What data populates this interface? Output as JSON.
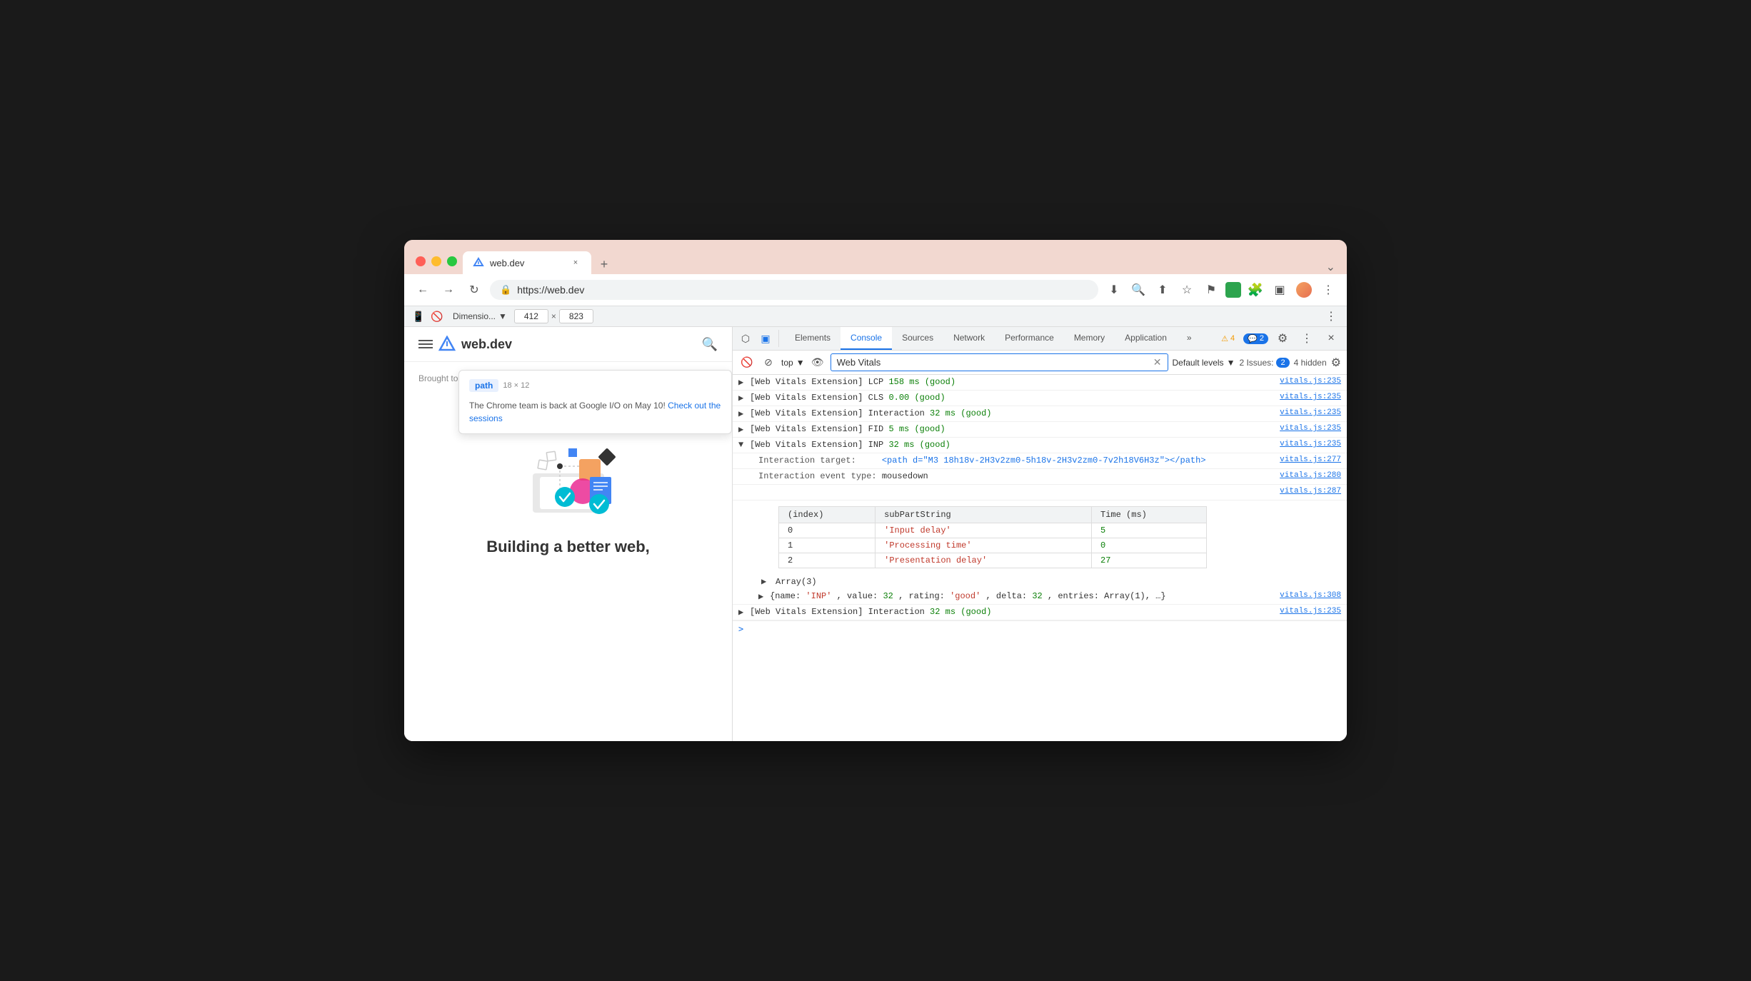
{
  "browser": {
    "tab_title": "web.dev",
    "tab_favicon": "▶",
    "url": "https://web.dev",
    "new_tab_icon": "+",
    "close_icon": "×"
  },
  "toolbar": {
    "back_icon": "←",
    "forward_icon": "→",
    "reload_icon": "↻",
    "lock_icon": "🔒",
    "download_icon": "⬇",
    "zoom_icon": "🔍",
    "share_icon": "⬆",
    "star_icon": "☆",
    "flag_icon": "⚑",
    "puzzle_icon": "🧩",
    "sidebar_icon": "▣",
    "menu_icon": "⋮",
    "chevron_down": "⌄"
  },
  "device_toolbar": {
    "device_label": "Dimensio...",
    "width": "412",
    "height": "823",
    "more_icon": "⋮"
  },
  "devtools": {
    "tabs": [
      {
        "label": "Elements",
        "active": false
      },
      {
        "label": "Console",
        "active": true
      },
      {
        "label": "Sources",
        "active": false
      },
      {
        "label": "Network",
        "active": false
      },
      {
        "label": "Performance",
        "active": false
      },
      {
        "label": "Memory",
        "active": false
      },
      {
        "label": "Application",
        "active": false
      }
    ],
    "more_tabs": "»",
    "warning_count": "4",
    "info_count": "2",
    "settings_icon": "⚙",
    "more_icon": "⋮",
    "close_icon": "×"
  },
  "console_toolbar": {
    "clear_icon": "🚫",
    "context_top": "top",
    "eye_icon": "👁",
    "search_placeholder": "Web Vitals",
    "search_value": "Web Vitals",
    "levels_label": "Default levels",
    "issues_label": "2 Issues:",
    "issues_count": "2",
    "hidden_label": "4 hidden",
    "settings_icon": "⚙"
  },
  "console_entries": [
    {
      "arrow": "▶",
      "prefix": "[Web Vitals Extension] LCP",
      "value": "158 ms",
      "rating": "(good)",
      "source": "vitals.js:235",
      "expanded": false
    },
    {
      "arrow": "▶",
      "prefix": "[Web Vitals Extension] CLS",
      "value": "0.00",
      "rating": "(good)",
      "source": "vitals.js:235",
      "expanded": false
    },
    {
      "arrow": "▶",
      "prefix": "[Web Vitals Extension] Interaction",
      "value": "32 ms",
      "rating": "(good)",
      "source": "vitals.js:235",
      "expanded": false
    },
    {
      "arrow": "▶",
      "prefix": "[Web Vitals Extension] FID",
      "value": "5 ms",
      "rating": "(good)",
      "source": "vitals.js:235",
      "expanded": false
    },
    {
      "arrow": "▼",
      "prefix": "[Web Vitals Extension] INP",
      "value": "32 ms",
      "rating": "(good)",
      "source": "vitals.js:235",
      "expanded": true
    }
  ],
  "inp_details": {
    "target_label": "Interaction target:",
    "target_value": "<path d=\"M3 18h18v-2H3v2zm0-5h18v-2H3v2zm0-7v2h18V6H3z\"></path>",
    "target_source": "vitals.js:277",
    "event_label": "Interaction event type:",
    "event_value": "mousedown",
    "event_source": "vitals.js:280",
    "blank_source": "vitals.js:287"
  },
  "table": {
    "columns": [
      "(index)",
      "subPartString",
      "Time (ms)"
    ],
    "rows": [
      {
        "index": "0",
        "subpart": "'Input delay'",
        "time": "5"
      },
      {
        "index": "1",
        "subpart": "'Processing time'",
        "time": "0"
      },
      {
        "index": "2",
        "subpart": "'Presentation delay'",
        "time": "27"
      }
    ]
  },
  "array_entry": {
    "arrow": "▶",
    "text": "Array(3)"
  },
  "object_entry": {
    "arrow": "▶",
    "text": "{name: 'INP', value: 32, rating: 'good', delta: 32, entries: Array(1), …}",
    "source": "vitals.js:308"
  },
  "last_entry": {
    "arrow": "▶",
    "prefix": "[Web Vitals Extension] Interaction",
    "value": "32 ms",
    "rating": "(good)",
    "source": "vitals.js:235"
  },
  "input_prompt": ">",
  "webpage": {
    "logo_text": "web.dev",
    "popup": {
      "tag": "path",
      "dimensions": "18 × 12",
      "text": "The Chrome team is back at Google I/O on May 10!",
      "link_text": "Check out the sessions"
    },
    "credit_text": "Brought to you by the Chrome DevRel team",
    "heading": "Building a better web,"
  }
}
